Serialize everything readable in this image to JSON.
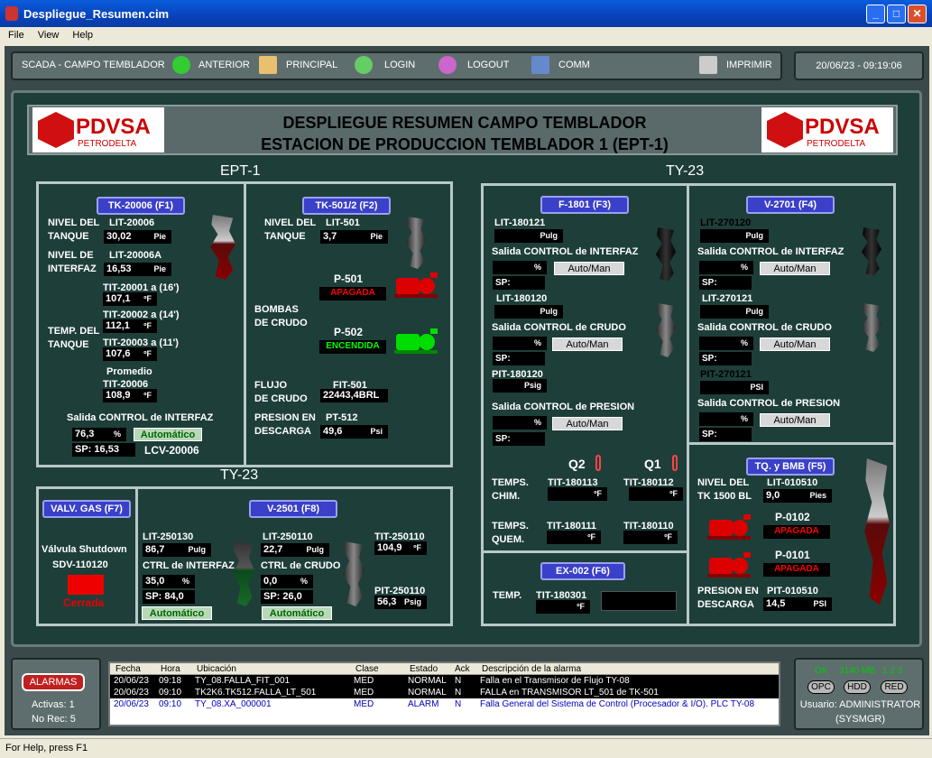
{
  "window": {
    "title": "Despliegue_Resumen.cim"
  },
  "menu": [
    "File",
    "View",
    "Help"
  ],
  "toolbar": {
    "app": "SCADA - CAMPO TEMBLADOR",
    "anterior": "ANTERIOR",
    "principal": "PRINCIPAL",
    "login": "LOGIN",
    "logout": "LOGOUT",
    "comm": "COMM",
    "imprimir": "IMPRIMIR",
    "datetime": "20/06/23 - 09:19:06"
  },
  "header": {
    "line1": "DESPLIEGUE RESUMEN CAMPO TEMBLADOR",
    "line2": "ESTACION DE PRODUCCION TEMBLADOR 1 (EPT-1)",
    "logo_name": "PDVSA",
    "logo_sub": "PETRODELTA"
  },
  "sections": {
    "ept1": "EPT-1",
    "ty23": "TY-23",
    "ty23b": "TY-23"
  },
  "tk20006": {
    "tag": "TK-20006 (F1)",
    "nivel_lbl1": "NIVEL DEL",
    "nivel_lbl2": "TANQUE",
    "lit1": "LIT-20006",
    "lit1_val": "30,02",
    "lit1_u": "Pie",
    "interfaz_lbl1": "NIVEL DE",
    "interfaz_lbl2": "INTERFAZ",
    "lit2": "LIT-20006A",
    "lit2_val": "16,53",
    "lit2_u": "Pie",
    "tit1": "TIT-20001 a (16')",
    "tit1_val": "107,1",
    "tit2": "TIT-20002 a (14')",
    "tit2_val": "112,1",
    "temp_lbl1": "TEMP. DEL",
    "temp_lbl2": "TANQUE",
    "tit3": "TIT-20003 a (11')",
    "tit3_val": "107,6",
    "prom_lbl": "Promedio",
    "prom_tag": "TIT-20006",
    "prom_val": "108,9",
    "deg": "ºF",
    "ctrl_lbl": "Salida CONTROL de INTERFAZ",
    "ctrl_val": "76,3",
    "pct": "%",
    "auto": "Automático",
    "sp_lbl": "SP:",
    "sp_val": "16,53",
    "lcv": "LCV-20006"
  },
  "tk501": {
    "tag": "TK-501/2 (F2)",
    "nivel_lbl1": "NIVEL DEL",
    "nivel_lbl2": "TANQUE",
    "lit": "LIT-501",
    "lit_val": "3,7",
    "lit_u": "Pie",
    "p501": "P-501",
    "p501_status": "APAGADA",
    "bombas1": "BOMBAS",
    "bombas2": "DE CRUDO",
    "p502": "P-502",
    "p502_status": "ENCENDIDA",
    "flujo1": "FLUJO",
    "flujo2": "DE CRUDO",
    "fit": "FIT-501",
    "fit_val": "22443,4BRL",
    "presion1": "PRESION EN",
    "presion2": "DESCARGA",
    "pt": "PT-512",
    "pt_val": "49,6",
    "pt_u": "Psi"
  },
  "f1801": {
    "tag": "F-1801 (F3)",
    "lit1": "LIT-180121",
    "lit1_u": "Pulg",
    "ctrl1": "Salida CONTROL de INTERFAZ",
    "lit2": "LIT-180120",
    "lit2_u": "Pulg",
    "ctrl2": "Salida CONTROL de CRUDO",
    "pit": "PIT-180120",
    "pit_u": "Psig",
    "ctrl3": "Salida CONTROL de PRESION",
    "pct": "%",
    "automan": "Auto/Man",
    "sp": "SP:",
    "q2": "Q2",
    "q1": "Q1",
    "chim1": "TEMPS.",
    "chim2": "CHIM.",
    "quem1": "TEMPS.",
    "quem2": "QUEM.",
    "t113": "TIT-180113",
    "t112": "TIT-180112",
    "t111": "TIT-180111",
    "t110": "TIT-180110",
    "deg": "ºF"
  },
  "v2701": {
    "tag": "V-2701 (F4)",
    "lit1": "LIT-270120",
    "lit1_u": "Pulg",
    "ctrl1": "Salida CONTROL de INTERFAZ",
    "lit2": "LIT-270121",
    "lit2_u": "Pulg",
    "ctrl2": "Salida CONTROL de CRUDO",
    "pit": "PIT-270121",
    "pit_u": "PSI",
    "ctrl3": "Salida CONTROL de PRESION",
    "pct": "%",
    "automan": "Auto/Man",
    "sp": "SP:"
  },
  "tqbmb": {
    "tag": "TQ. y BMB (F5)",
    "nivel1": "NIVEL DEL",
    "nivel2": "TK 1500 BL",
    "lit": "LIT-010510",
    "lit_val": "9,0",
    "lit_u": "Pies",
    "p0102": "P-0102",
    "p0102_status": "APAGADA",
    "p0101": "P-0101",
    "p0101_status": "APAGADA",
    "presion1": "PRESION EN",
    "presion2": "DESCARGA",
    "pit": "PIT-010510",
    "pit_val": "14,5",
    "pit_u": "PSI"
  },
  "ex002": {
    "tag": "EX-002 (F6)",
    "temp": "TEMP.",
    "tit": "TIT-180301",
    "deg": "ºF"
  },
  "valv": {
    "tag": "VALV. GAS (F7)",
    "lbl1": "Válvula Shutdown",
    "lbl2": "SDV-110120",
    "status": "Cerrada"
  },
  "v2501": {
    "tag": "V-2501 (F8)",
    "lit1": "LIT-250130",
    "lit1_val": "86,7",
    "lit1_u": "Pulg",
    "ctrl1": "CTRL de INTERFAZ",
    "ctrl1_val": "35,0",
    "sp1": "SP: 84,0",
    "auto": "Automático",
    "lit2": "LIT-250110",
    "lit2_val": "22,7",
    "lit2_u": "Pulg",
    "ctrl2": "CTRL de CRUDO",
    "ctrl2_val": "0,0",
    "sp2": "SP: 26,0",
    "pct": "%",
    "tit": "TIT-250110",
    "tit_val": "104,9",
    "deg": "ºF",
    "pit": "PIT-250110",
    "pit_val": "56,3",
    "pit_u": "Psig"
  },
  "alarms": {
    "button": "ALARMAS",
    "activas": "Activas: 1",
    "norec": "No Rec: 5",
    "headers": [
      "Fecha",
      "Hora",
      "Ubicación",
      "Clase",
      "Estado",
      "Ack",
      "Descripción de la alarma"
    ],
    "rows": [
      [
        "20/06/23",
        "09:18",
        "TY_08.FALLA_FIT_001",
        "MED",
        "NORMAL",
        "N",
        "Falla en el Transmisor de Flujo TY-08"
      ],
      [
        "20/06/23",
        "09:10",
        "TK2K6.TK512.FALLA_LT_501",
        "MED",
        "NORMAL",
        "N",
        "FALLA en TRANSMISOR LT_501 de TK-501"
      ],
      [
        "20/06/23",
        "09:10",
        "TY_08.XA_000001",
        "MED",
        "ALARM",
        "N",
        "Falla General del Sistema de Control (Procesador & I/O). PLC TY-08"
      ]
    ]
  },
  "system": {
    "ok": "OK",
    "mem": "3140 MB",
    "nums": "1 2 3",
    "opc": "OPC",
    "hdd": "HDD",
    "red": "RED",
    "user": "Usuario: ADMINISTRATOR",
    "group": "(SYSMGR)"
  },
  "statusbar": "For Help, press F1"
}
